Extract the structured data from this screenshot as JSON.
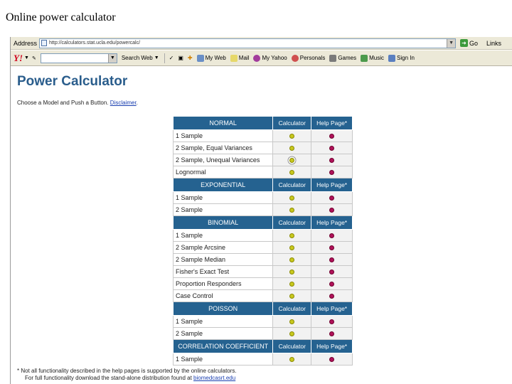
{
  "slide": {
    "title": "Online power calculator"
  },
  "browser": {
    "address_label": "Address",
    "url": "http://calculators.stat.ucla.edu/powercalc/",
    "go_label": "Go",
    "links_label": "Links",
    "toolbar": {
      "logo": "Y!",
      "search_label": "Search Web",
      "my_web": "My Web",
      "mail": "Mail",
      "my_yahoo": "My Yahoo",
      "personals": "Personals",
      "games": "Games",
      "music": "Music",
      "sign_in": "Sign In"
    }
  },
  "page": {
    "heading": "Power Calculator",
    "intro_text": "Choose a Model and Push a Button.",
    "disclaimer_link": "Disclaimer",
    "intro_end": ".",
    "col_calculator": "Calculator",
    "col_help": "Help Page*",
    "sections": [
      {
        "title": "NORMAL",
        "rows": [
          "1 Sample",
          "2 Sample, Equal Variances",
          "2 Sample, Unequal Variances",
          "Lognormal"
        ]
      },
      {
        "title": "EXPONENTIAL",
        "rows": [
          "1 Sample",
          "2 Sample"
        ]
      },
      {
        "title": "BINOMIAL",
        "rows": [
          "1 Sample",
          "2 Sample Arcsine",
          "2 Sample Median",
          "Fisher's Exact Test",
          "Proportion Responders",
          "Case Control"
        ]
      },
      {
        "title": "POISSON",
        "rows": [
          "1 Sample",
          "2 Sample"
        ]
      },
      {
        "title": "CORRELATION COEFFICIENT",
        "rows": [
          "1 Sample"
        ]
      }
    ],
    "footnote_1": "* Not all functionality described in the help pages is supported by the online calculators.",
    "footnote_2": "For full functionality download the stand-alone distribution found at",
    "footnote_link": "biomedcasrt.edu"
  },
  "colors": {
    "header_blue": "#256290",
    "heading_blue": "#2a5d8c",
    "calc_dot": "#c8c81e",
    "help_dot": "#b0125a",
    "chrome": "#ece9d8"
  }
}
